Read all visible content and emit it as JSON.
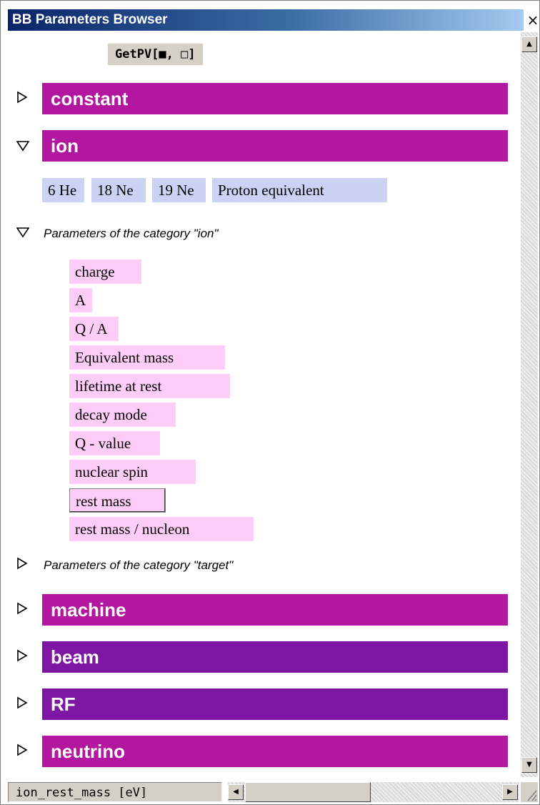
{
  "window": {
    "title": "BB Parameters Browser",
    "close_glyph": "×"
  },
  "getpv_button": {
    "label": "GetPV[■, □]"
  },
  "categories": [
    {
      "label": "constant",
      "state": "collapsed",
      "color": "#b3179f"
    },
    {
      "label": "ion",
      "state": "expanded",
      "color": "#b3179f"
    },
    {
      "label": "machine",
      "state": "collapsed",
      "color": "#b3179f"
    },
    {
      "label": "beam",
      "state": "collapsed",
      "color": "#7d16a2"
    },
    {
      "label": "RF",
      "state": "collapsed",
      "color": "#7d16a2"
    },
    {
      "label": "neutrino",
      "state": "collapsed",
      "color": "#b3179f"
    }
  ],
  "ion_options": [
    "6 He",
    "18 Ne",
    "19 Ne",
    "Proton equivalent"
  ],
  "ion_params_section": {
    "title": "Parameters of the category \"ion\"",
    "state": "expanded",
    "selected": "rest mass",
    "items": [
      "charge",
      "A",
      "Q / A",
      "Equivalent mass",
      "lifetime at rest",
      "decay mode",
      "Q - value",
      "nuclear spin",
      "rest mass",
      "rest mass / nucleon"
    ]
  },
  "target_params_section": {
    "title": "Parameters of the category \"target\"",
    "state": "collapsed"
  },
  "status_bar": {
    "text": "ion_rest_mass [eV]"
  },
  "icons": {
    "collapsed": "triangle-right-icon",
    "expanded": "triangle-down-icon"
  },
  "colors": {
    "ion_option_bg": "#cbd2f3",
    "param_bg": "#fdcdf8",
    "title_bar": "#0a246a"
  }
}
